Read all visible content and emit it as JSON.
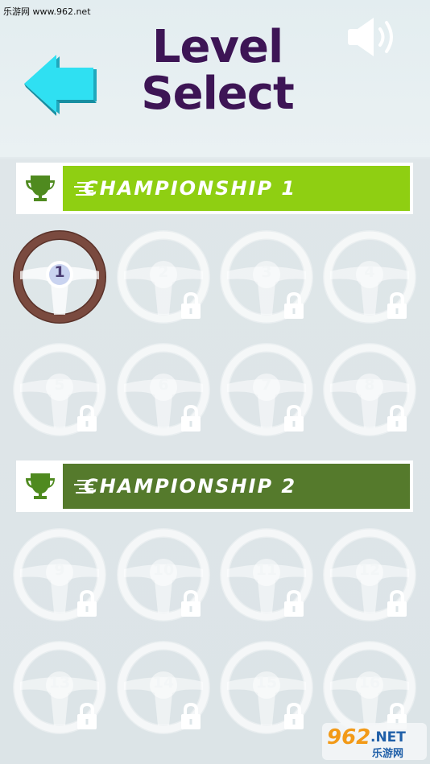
{
  "watermark_top": "乐游网 www.962.net",
  "header": {
    "title_line1": "Level",
    "title_line2": "Select"
  },
  "championships": [
    {
      "label": "CHAMPIONSHIP 1",
      "color": "#8fcf12",
      "levels": [
        {
          "num": "1",
          "locked": false,
          "selected": true
        },
        {
          "num": "2",
          "locked": true
        },
        {
          "num": "3",
          "locked": true
        },
        {
          "num": "4",
          "locked": true
        },
        {
          "num": "5",
          "locked": true
        },
        {
          "num": "6",
          "locked": true
        },
        {
          "num": "7",
          "locked": true
        },
        {
          "num": "8",
          "locked": true
        }
      ]
    },
    {
      "label": "CHAMPIONSHIP 2",
      "color": "#557a2c",
      "levels": [
        {
          "num": "9",
          "locked": true
        },
        {
          "num": "10",
          "locked": true
        },
        {
          "num": "11",
          "locked": true
        },
        {
          "num": "12",
          "locked": true
        },
        {
          "num": "13",
          "locked": true
        },
        {
          "num": "14",
          "locked": true
        },
        {
          "num": "15",
          "locked": true
        },
        {
          "num": "16",
          "locked": true
        }
      ]
    }
  ],
  "watermark_bottom": {
    "text_962": "962",
    "text_net": ".NET",
    "text_cn": "乐游网"
  },
  "colors": {
    "title": "#3d1555",
    "arrow": "#2fd3e6",
    "trophy": "#4f8a1f",
    "wheel_rim_active": "#7a4a3f"
  }
}
